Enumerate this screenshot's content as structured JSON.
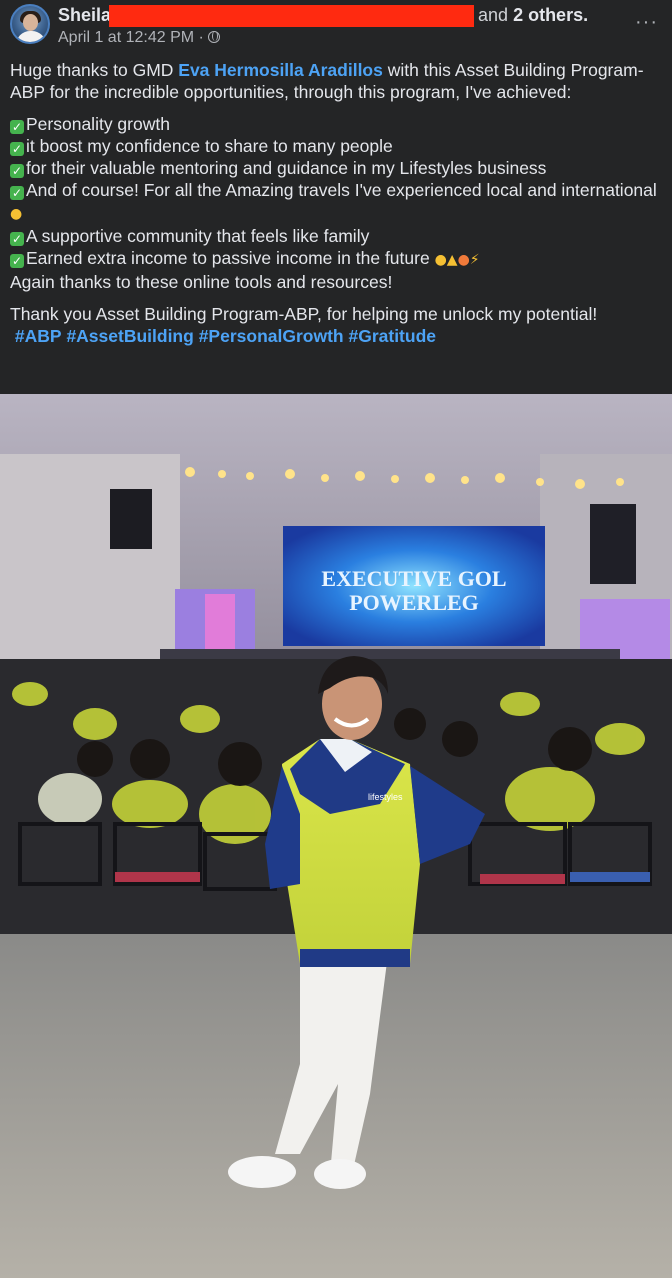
{
  "post": {
    "author_prefix": "Sheila",
    "and_text": "and",
    "others": "2 others.",
    "timestamp": "April 1 at 12:42 PM",
    "separator": "·",
    "privacy_icon": "globe-icon",
    "more_icon": "more-horizontal-icon",
    "more_label": "···"
  },
  "text": {
    "intro_1": "Huge thanks to GMD ",
    "mention": "Eva Hermosilla Aradillos",
    "intro_2": " with this Asset Building Program- ABP for the incredible opportunities, through this program, I've achieved:",
    "check_icon": "check-mark-button-emoji",
    "achievements": [
      "Personality growth",
      "it boost my confidence to share to many people",
      "for their valuable mentoring and guidance in my Lifestyles business",
      "And of course! For all the Amazing travels I've experienced local and international ",
      "A supportive community that feels like family",
      "Earned extra income to passive income in the future "
    ],
    "thanks": "Again thanks to these online tools and resources!",
    "closing": "Thank you Asset Building Program-ABP, for helping me unlock my potential!",
    "hashtags": [
      "#ABP",
      "#AssetBuilding",
      "#PersonalGrowth",
      "#Gratitude"
    ]
  },
  "photo": {
    "screen_line_1": "EXECUTIVE GOL",
    "screen_line_2": "POWERLEG",
    "jacket_logo": "lifestyles"
  },
  "colors": {
    "background": "#242526",
    "text": "#e4e6eb",
    "secondary": "#b0b3b8",
    "link": "#4da3f5",
    "redaction": "#ff2a10",
    "check": "#45b34e"
  }
}
